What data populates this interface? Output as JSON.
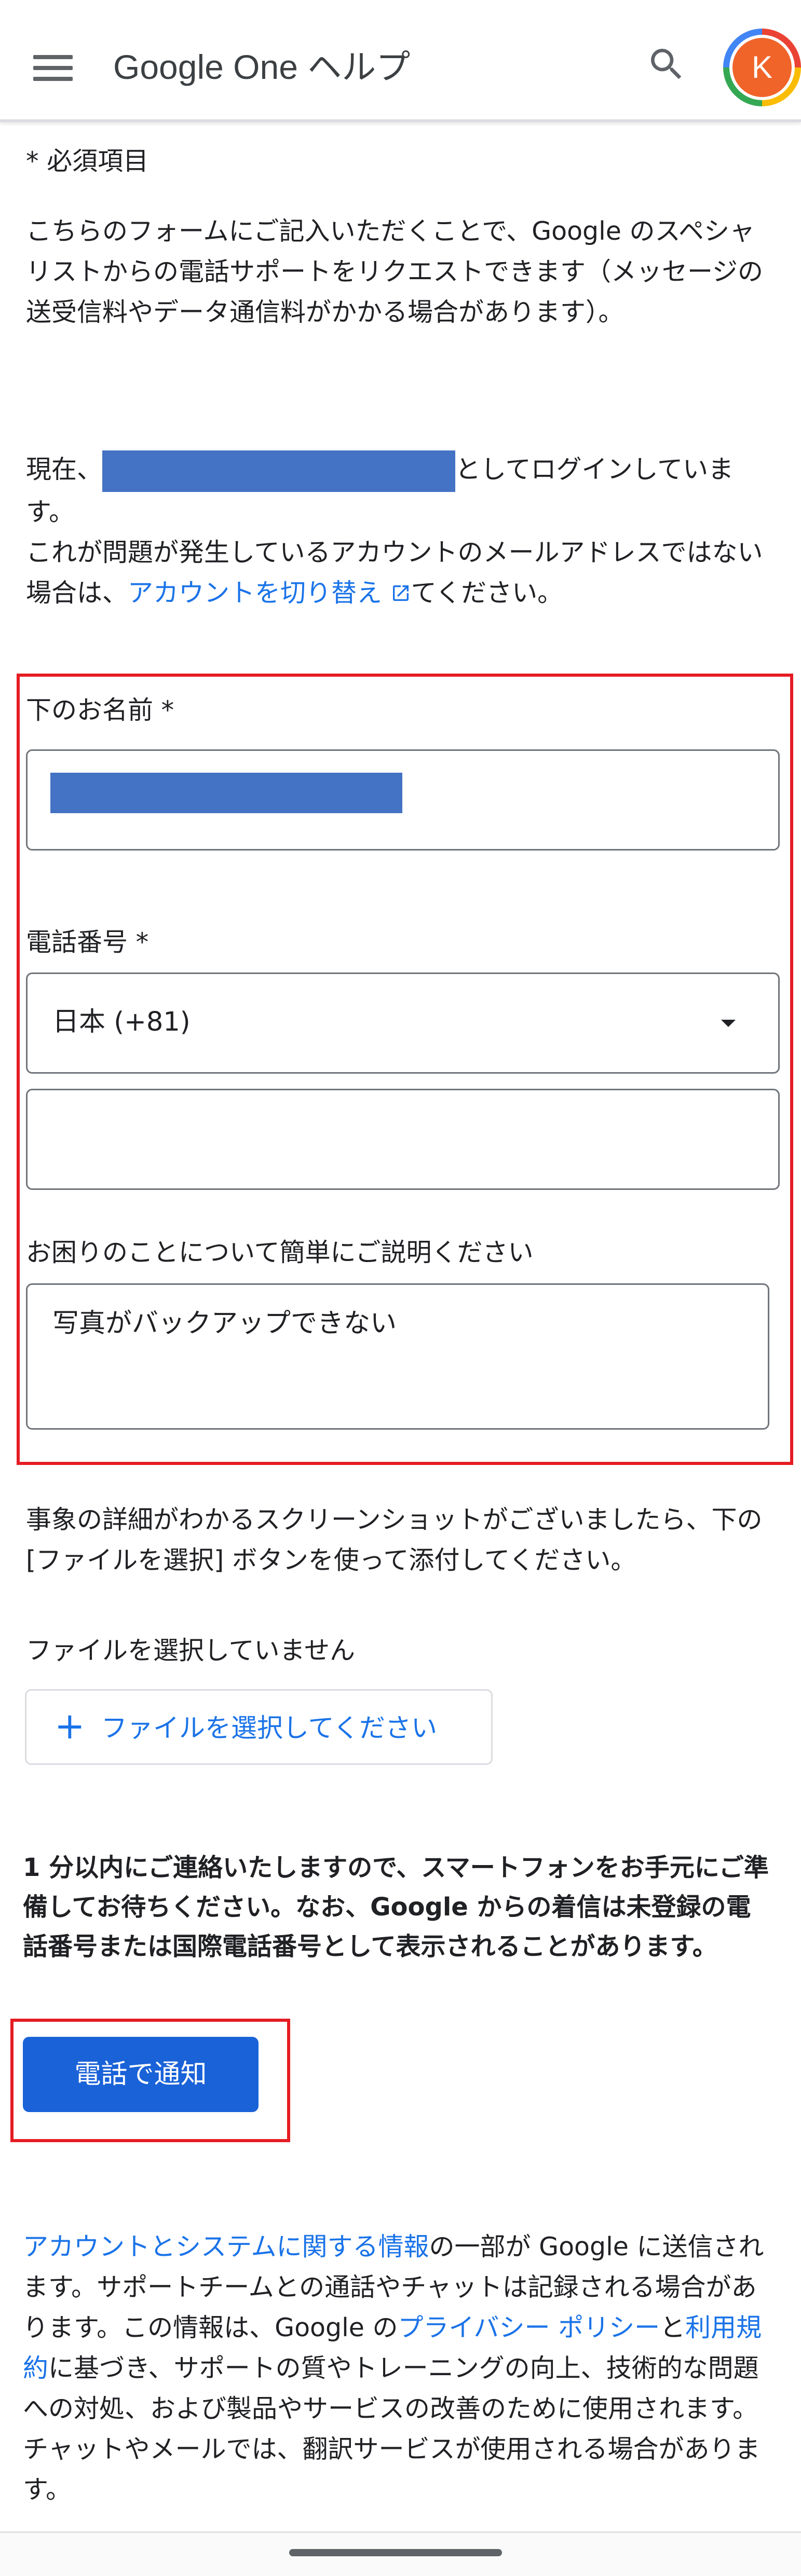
{
  "appbar": {
    "title": "Google One ヘルプ",
    "avatar_letter": "K"
  },
  "form": {
    "required_note": "* 必須項目",
    "intro": "こちらのフォームにご記入いただくことで、Google のスペシャリストからの電話サポートをリクエストできます（メッセージの送受信料やデータ通信料がかかる場合があります）。",
    "login_prefix": "現在、",
    "login_suffix": "としてログインしています。",
    "switch_prefix": "これが問題が発生しているアカウントのメールアドレスではない場合は、",
    "switch_link": "アカウントを切り替え",
    "switch_suffix": "てください。",
    "name_label": "下のお名前 *",
    "phone_label": "電話番号 *",
    "country_selected": "日本 (+81)",
    "phone_value": "",
    "description_label": "お困りのことについて簡単にご説明ください",
    "description_value": "写真がバックアップできない",
    "screenshot_note": "事象の詳細がわかるスクリーンショットがございましたら、下の [ファイルを選択] ボタンを使って添付してください。",
    "no_file": "ファイルを選択していません",
    "file_button": "ファイルを選択してください",
    "callback_notice": "1 分以内にご連絡いたしますので、スマートフォンをお手元にご準備してお待ちください。なお、Google からの着信は未登録の電話番号または国際電話番号として表示されることがあります。",
    "call_button": "電話で通知"
  },
  "footer": {
    "link_account_info": "アカウントとシステムに関する情報",
    "text1": "の一部が Google に送信されます。サポートチームとの通話やチャットは記録される場合があります。この情報は、Google の",
    "link_privacy": "プライバシー ポリシー",
    "text2": "と",
    "link_terms": "利用規約",
    "text3": "に基づき、サポートの質やトレーニングの向上、技術的な問題への対処、および製品やサービスの改善のために使用されます。チャットやメールでは、翻訳サービスが使用される場合があります。"
  },
  "colors": {
    "accent": "#1a73e8",
    "button": "#1a62d8",
    "highlight": "#e51c23",
    "redaction": "#4472c4",
    "avatar": "#f0642a"
  },
  "icons": [
    "menu-icon",
    "search-icon",
    "external-link-icon",
    "dropdown-caret-icon",
    "plus-icon"
  ]
}
